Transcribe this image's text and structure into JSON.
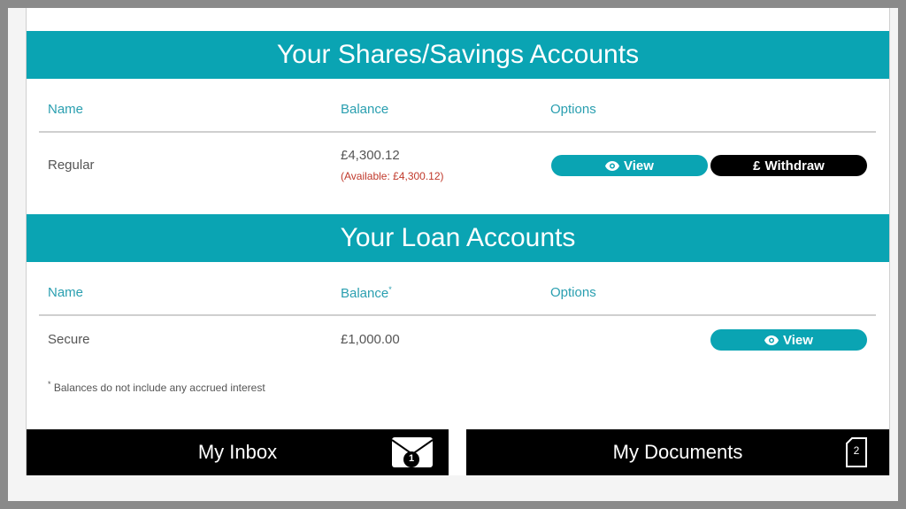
{
  "savings": {
    "title": "Your Shares/Savings Accounts",
    "columns": {
      "name": "Name",
      "balance": "Balance",
      "options": "Options"
    },
    "rows": [
      {
        "name": "Regular",
        "balance": "£4,300.12",
        "available": "(Available: £4,300.12)",
        "view_label": "View",
        "withdraw_label": "Withdraw"
      }
    ]
  },
  "loans": {
    "title": "Your Loan Accounts",
    "columns": {
      "name": "Name",
      "balance": "Balance",
      "balance_marker": "*",
      "options": "Options"
    },
    "rows": [
      {
        "name": "Secure",
        "balance": "£1,000.00",
        "view_label": "View"
      }
    ],
    "footnote_marker": "*",
    "footnote": "Balances do not include any accrued interest"
  },
  "footer": {
    "inbox_label": "My Inbox",
    "inbox_count": "1",
    "documents_label": "My Documents",
    "documents_count": "2"
  },
  "colors": {
    "accent": "#0aa4b3",
    "available_text": "#c0392b",
    "footer_bg": "#000000"
  },
  "icons": {
    "view": "eye-icon",
    "withdraw": "pound-icon",
    "inbox": "envelope-icon",
    "documents": "document-icon"
  }
}
